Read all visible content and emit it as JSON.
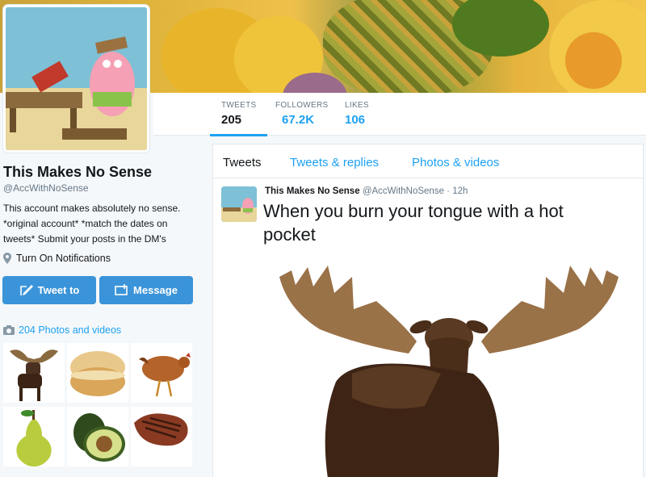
{
  "profile": {
    "name": "This Makes No Sense",
    "handle": "@AccWithNoSense",
    "bio": "This account makes absolutely no sense. *original account* *match the dates on tweets* Submit your posts in the DM's",
    "notifications": "Turn On Notifications",
    "tweet_to_label": "Tweet to",
    "message_label": "Message",
    "photos_link": "204 Photos and videos"
  },
  "stats": [
    {
      "label": "TWEETS",
      "value": "205"
    },
    {
      "label": "FOLLOWERS",
      "value": "67.2K"
    },
    {
      "label": "LIKES",
      "value": "106"
    }
  ],
  "tabs": [
    "Tweets",
    "Tweets & replies",
    "Photos & videos"
  ],
  "tweet": {
    "name": "This Makes No Sense",
    "handle": "@AccWithNoSense",
    "time": "12h",
    "text": "When you burn your tongue with a hot pocket"
  },
  "colors": {
    "accent": "#1da1f2",
    "button": "#3b94d9",
    "muted": "#657786"
  },
  "thumbnails": [
    "moose",
    "biscuit",
    "chicken",
    "pear",
    "avocado",
    "steak"
  ]
}
